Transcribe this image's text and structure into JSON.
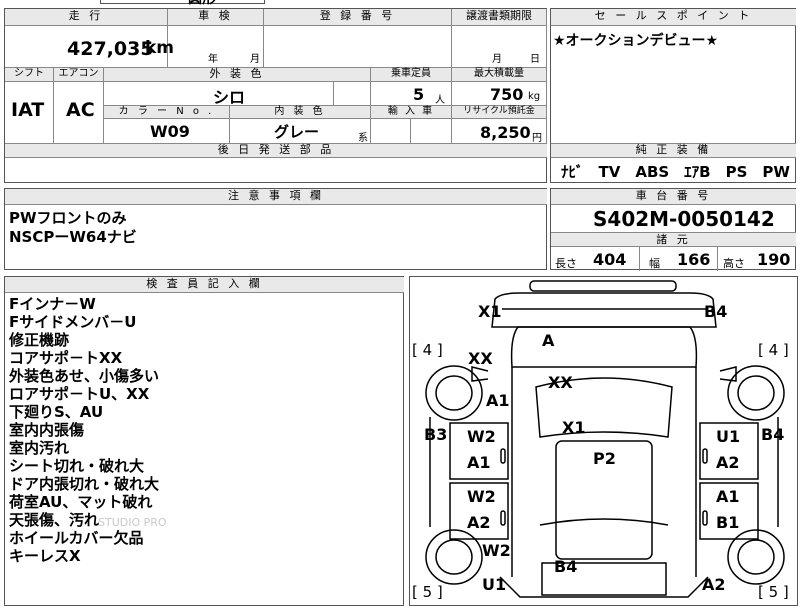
{
  "top_fragment": "圆形",
  "mileage": {
    "label": "走 行",
    "value": "427,035",
    "unit": "km"
  },
  "inspection": {
    "label": "車 検",
    "year_unit": "年",
    "month_unit": "月"
  },
  "registration": {
    "label": "登 録 番 号"
  },
  "transfer_docs": {
    "label": "譲渡書類期限",
    "month_unit": "月",
    "day_unit": "日"
  },
  "sales_point": {
    "label": "セ ー ル ス ポ イ ン ト",
    "text": "★オークションデビュー★"
  },
  "shift": {
    "label": "シフト",
    "value": "IAT"
  },
  "aircon": {
    "label": "エアコン",
    "value": "AC"
  },
  "exterior_color": {
    "label": "外 装 色",
    "value": "シロ"
  },
  "capacity": {
    "label": "乗車定員",
    "value": "5",
    "unit": "人"
  },
  "max_load": {
    "label": "最大積載量",
    "value": "750",
    "unit": "kg"
  },
  "color_no": {
    "label": "カ ラ ー N o .",
    "value": "W09"
  },
  "interior_color": {
    "label": "内 装 色",
    "value": "グレー",
    "suffix": "系"
  },
  "import": {
    "label": "輸 入 車"
  },
  "recycle": {
    "label": "リサイクル預託金",
    "value": "8,250",
    "unit": "円"
  },
  "shipping_parts": {
    "label": "後 日 発 送 部 品"
  },
  "genuine_equipment": {
    "label": "純 正 装 備",
    "value": "ﾅﾋﾞ　TV　ABS　ｴｱB　PS　PW"
  },
  "notes": {
    "label": "注 意 事 項 欄",
    "lines": [
      "PWフロントのみ",
      "NSCPーW64ナビ"
    ]
  },
  "chassis": {
    "label": "車 台 番 号",
    "value": "S402M-0050142"
  },
  "specs": {
    "label": "諸 元",
    "length_label": "長さ",
    "length": "404",
    "width_label": "幅",
    "width": "166",
    "height_label": "高さ",
    "height": "190"
  },
  "inspector": {
    "label": "検 査 員 記 入 欄",
    "lines": [
      "Fインナ－W",
      "Fサイドメンバ－U",
      "修正機跡",
      "コアサポ－トXX",
      "外装色あせ、小傷多い",
      "ロアサポ－トU、XX",
      "下廻りS、AU",
      "室内内張傷",
      "室内汚れ",
      "シート切れ・破れ大",
      "ドア内張切れ・破れ大",
      "荷室AU、マット破れ",
      "天張傷、汚れ",
      "ホイールカバー欠品",
      "キーレスX"
    ]
  },
  "watermark": "STUDIO PRO",
  "diagram": {
    "X1_tl": "X1",
    "B4_tr": "B4",
    "tire_fl": "[ 4 ]",
    "tire_fr": "[ 4 ]",
    "XX_hood_l": "XX",
    "A_glass": "A",
    "XX_hood": "XX",
    "A1_fender": "A1",
    "B3": "B3",
    "B4_right": "B4",
    "X1_roof": "X1",
    "W2_fdl": "W2",
    "U1_fdr": "U1",
    "A1_fdl": "A1",
    "A2_fdr": "A2",
    "P2": "P2",
    "W2_rdl": "W2",
    "A1_rdr": "A1",
    "A2_rdl": "A2",
    "B1_rdr": "B1",
    "W2_rq": "W2",
    "B4_rear": "B4",
    "U1_rear": "U1",
    "A2_rear": "A2",
    "tire_rl": "[ 5 ]",
    "tire_rr": "[ 5 ]"
  }
}
